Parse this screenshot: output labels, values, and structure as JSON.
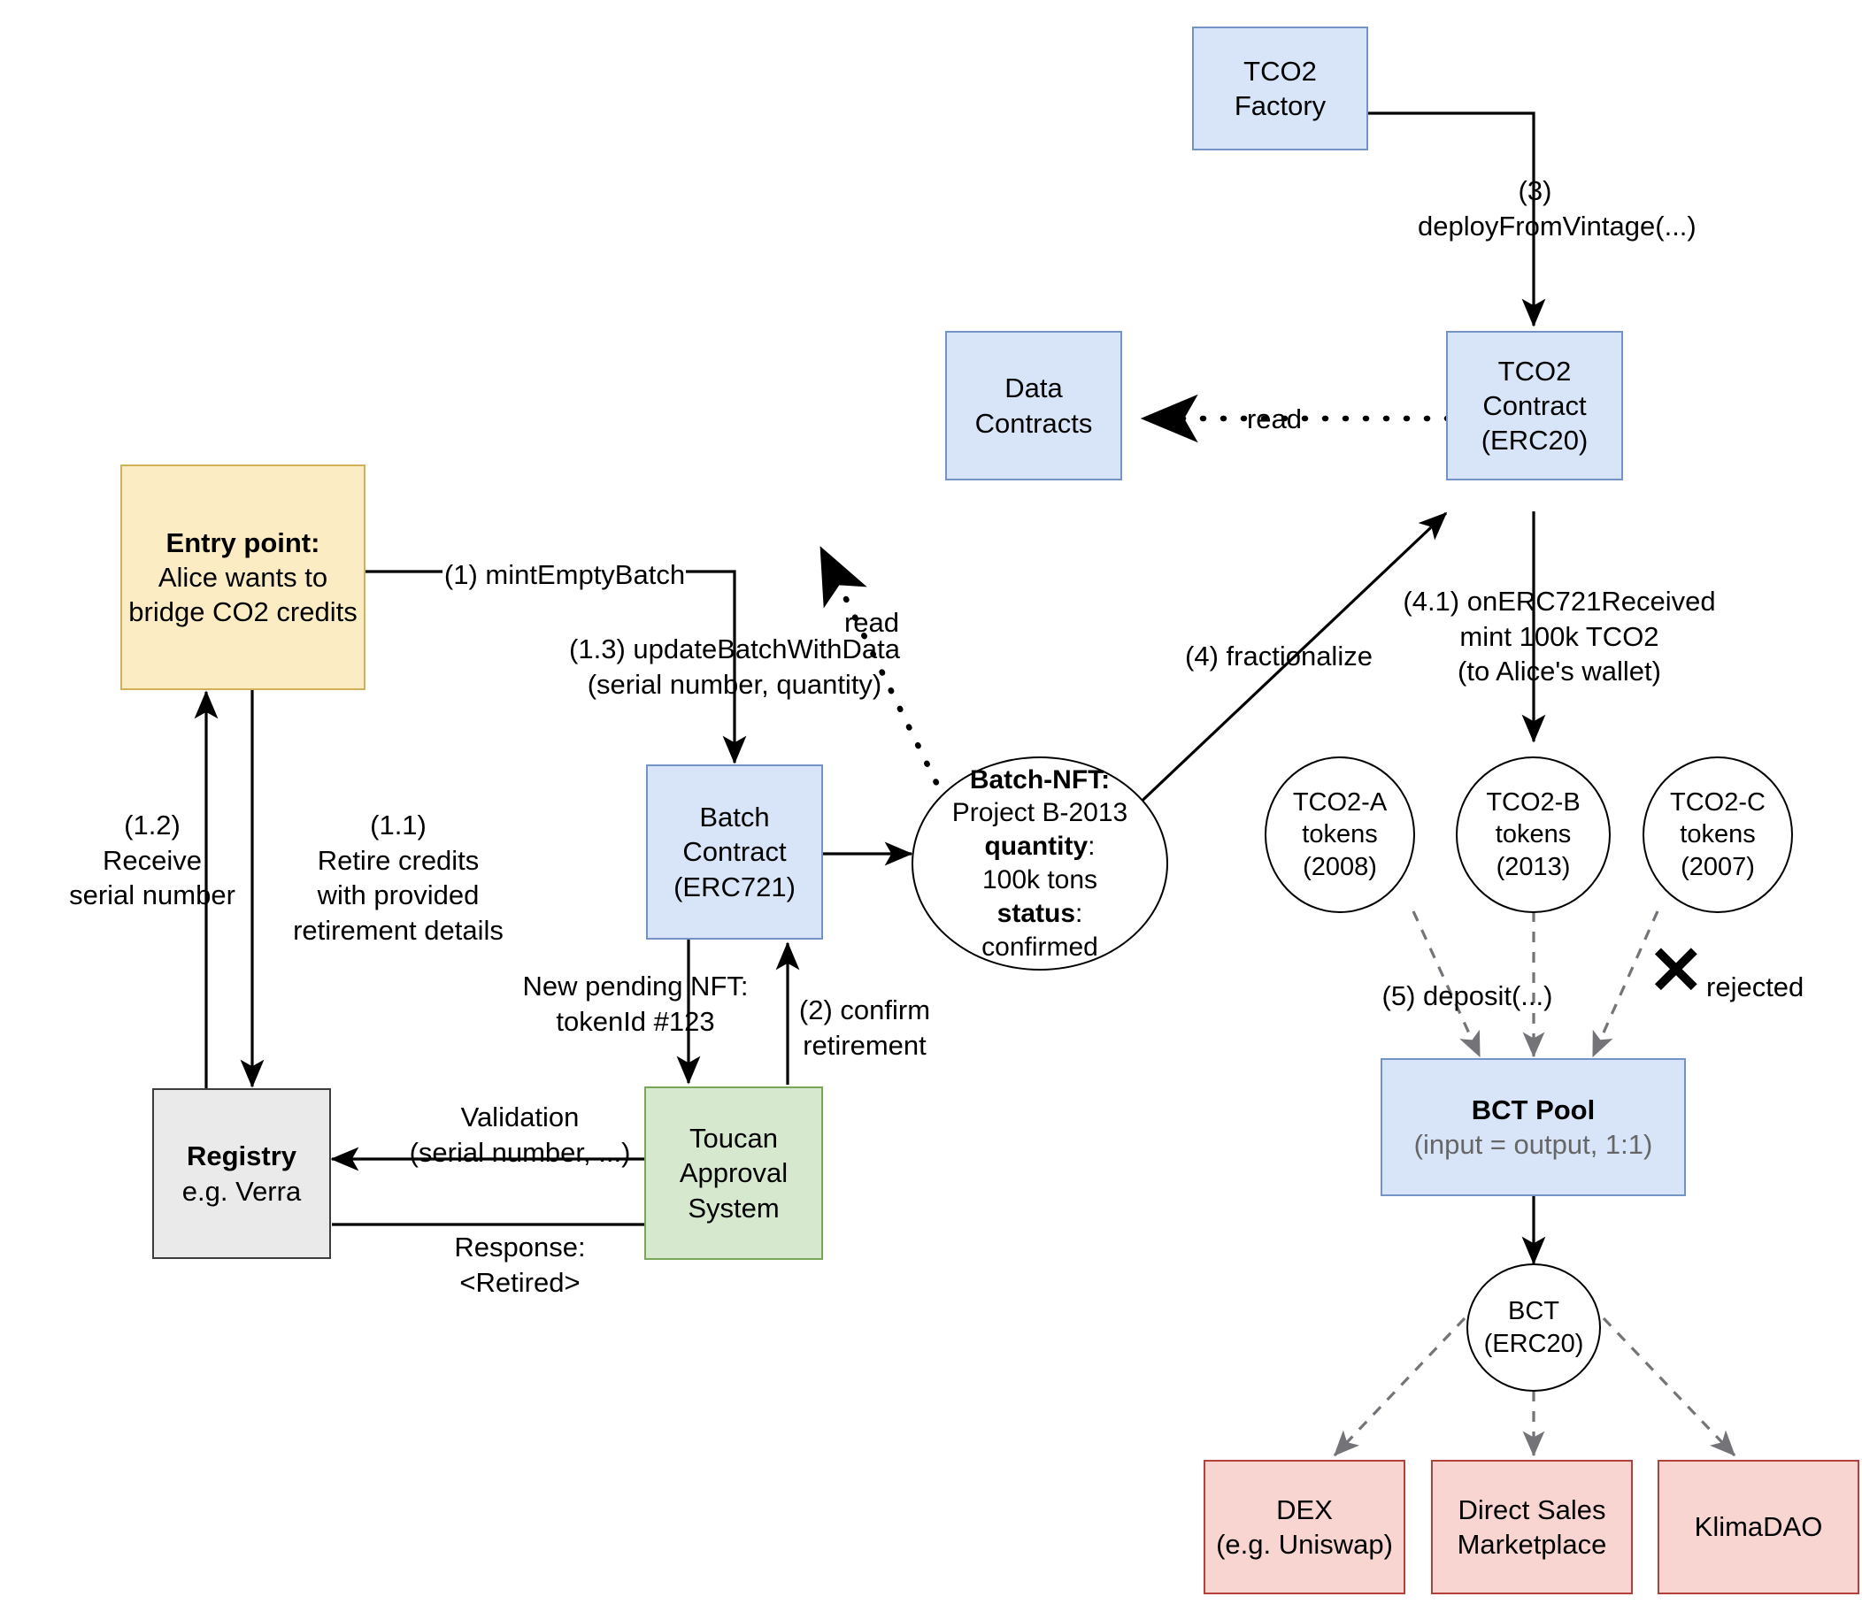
{
  "diagram": {
    "title": "Toucan Protocol carbon credit bridging flow",
    "colors": {
      "blue_fill": "#d8e5f8",
      "blue_stroke": "#7394c4",
      "yellow_fill": "#fcecc3",
      "yellow_stroke": "#d1b05a",
      "grey_fill": "#eaeaea",
      "grey_stroke": "#3d3d40",
      "green_fill": "#d6e8cd",
      "green_stroke": "#7aa65a",
      "red_fill": "#f8d5d1",
      "red_stroke": "#b3413a",
      "dashed_arrow": "#737378",
      "line": "#000000"
    }
  },
  "nodes": {
    "tco2_factory": {
      "line1": "TCO2",
      "line2": "Factory"
    },
    "data_contracts": {
      "line1": "Data",
      "line2": "Contracts"
    },
    "tco2_contract": {
      "line1": "TCO2",
      "line2": "Contract",
      "line3": "(ERC20)"
    },
    "entry_point": {
      "line1": "Entry point:",
      "line2": "Alice wants to",
      "line3": "bridge CO2 credits"
    },
    "batch_contract": {
      "line1": "Batch",
      "line2": "Contract",
      "line3": "(ERC721)"
    },
    "batch_nft": {
      "line1": "Batch-NFT:",
      "line2": "Project B-2013",
      "line3": "quantity",
      "line3b": ":",
      "line4": "100k tons",
      "line5": "status",
      "line5b": ":",
      "line6": "confirmed"
    },
    "registry": {
      "line1": "Registry",
      "line2": "e.g. Verra"
    },
    "toucan_approval": {
      "line1": "Toucan",
      "line2": "Approval",
      "line3": "System"
    },
    "tco2_a": {
      "line1": "TCO2-A",
      "line2": "tokens",
      "line3": "(2008)"
    },
    "tco2_b": {
      "line1": "TCO2-B",
      "line2": "tokens",
      "line3": "(2013)"
    },
    "tco2_c": {
      "line1": "TCO2-C",
      "line2": "tokens",
      "line3": "(2007)"
    },
    "bct_pool": {
      "line1": "BCT Pool",
      "line2": "(input = output, 1:1)"
    },
    "bct_token": {
      "line1": "BCT",
      "line2": "(ERC20)"
    },
    "dex": {
      "line1": "DEX",
      "line2": "(e.g. Uniswap)"
    },
    "direct_sales": {
      "line1": "Direct Sales",
      "line2": "Marketplace"
    },
    "klimadao": {
      "line1": "KlimaDAO"
    }
  },
  "edge_labels": {
    "deploy_from_vintage": "(3)\ndeployFromVintage(...)",
    "read_tco2": "read",
    "read_batch": "read",
    "mint_empty_batch": "(1) mintEmptyBatch",
    "update_batch_with_data": "(1.3) updateBatchWithData\n(serial number, quantity)",
    "receive_serial_number": "(1.2)\nReceive\nserial number",
    "retire_credits": "(1.1)\nRetire credits\nwith provided\nretirement details",
    "new_pending_nft": "New pending NFT:\ntokenId #123",
    "confirm_retirement": "(2) confirm\nretirement",
    "validation": "Validation\n(serial number, ...)",
    "response": "Response:\n<Retired>",
    "fractionalize": "(4) fractionalize",
    "on_erc721_received": "(4.1) onERC721Received\nmint 100k TCO2\n(to Alice's wallet)",
    "deposit": "(5) deposit(...)",
    "rejected": "rejected",
    "reject_mark": "✕"
  }
}
